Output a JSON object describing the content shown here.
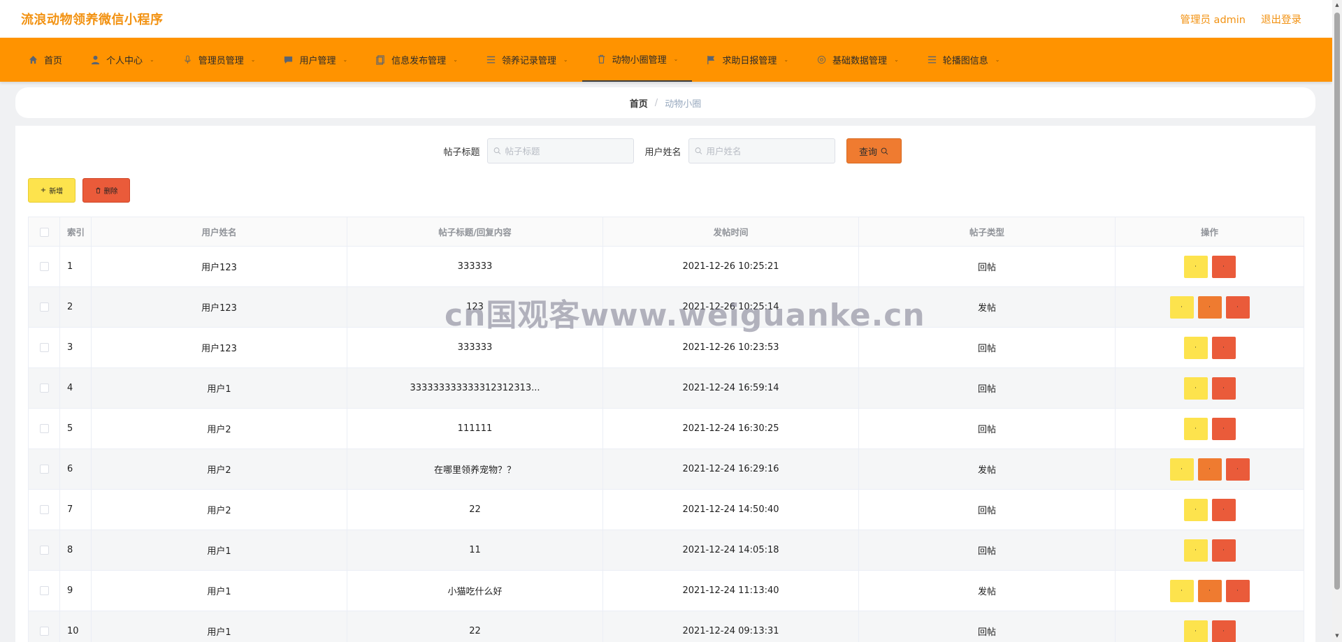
{
  "header": {
    "app_title": "流浪动物领养微信小程序",
    "admin_label": "管理员 admin",
    "logout_label": "退出登录"
  },
  "nav": {
    "items": [
      {
        "label": "首页",
        "icon": "home-icon"
      },
      {
        "label": "个人中心",
        "icon": "user-icon"
      },
      {
        "label": "管理员管理",
        "icon": "mic-icon"
      },
      {
        "label": "用户管理",
        "icon": "chat-icon"
      },
      {
        "label": "信息发布管理",
        "icon": "document-icon"
      },
      {
        "label": "领养记录管理",
        "icon": "list-icon"
      },
      {
        "label": "动物小圈管理",
        "icon": "trash-icon"
      },
      {
        "label": "求助日报管理",
        "icon": "flag-icon"
      },
      {
        "label": "基础数据管理",
        "icon": "gear-icon"
      },
      {
        "label": "轮播图信息",
        "icon": "list-icon"
      }
    ]
  },
  "breadcrumb": {
    "home": "首页",
    "separator": "/",
    "current": "动物小圈"
  },
  "search": {
    "title_label": "帖子标题",
    "title_placeholder": "帖子标题",
    "user_label": "用户姓名",
    "user_placeholder": "用户姓名",
    "query_label": "查询"
  },
  "actions": {
    "add_label": "新增",
    "delete_label": "删除"
  },
  "table": {
    "columns": [
      "索引",
      "用户姓名",
      "帖子标题/回复内容",
      "发帖时间",
      "帖子类型",
      "操作"
    ],
    "rows": [
      {
        "index": "1",
        "user": "用户123",
        "content": "333333",
        "time": "2021-12-26 10:25:21",
        "type": "回帖"
      },
      {
        "index": "2",
        "user": "用户123",
        "content": "123",
        "time": "2021-12-26 10:25:14",
        "type": "发帖"
      },
      {
        "index": "3",
        "user": "用户123",
        "content": "333333",
        "time": "2021-12-26 10:23:53",
        "type": "回帖"
      },
      {
        "index": "4",
        "user": "用户1",
        "content": "333333333333312312313...",
        "time": "2021-12-24 16:59:14",
        "type": "回帖"
      },
      {
        "index": "5",
        "user": "用户2",
        "content": "111111",
        "time": "2021-12-24 16:30:25",
        "type": "回帖"
      },
      {
        "index": "6",
        "user": "用户2",
        "content": "在哪里领养宠物？？",
        "time": "2021-12-24 16:29:16",
        "type": "发帖"
      },
      {
        "index": "7",
        "user": "用户2",
        "content": "22",
        "time": "2021-12-24 14:50:40",
        "type": "回帖"
      },
      {
        "index": "8",
        "user": "用户1",
        "content": "11",
        "time": "2021-12-24 14:05:18",
        "type": "回帖"
      },
      {
        "index": "9",
        "user": "用户1",
        "content": "小猫吃什么好",
        "time": "2021-12-24 11:13:40",
        "type": "发帖"
      },
      {
        "index": "10",
        "user": "用户1",
        "content": "22",
        "time": "2021-12-24 09:13:31",
        "type": "回帖"
      }
    ],
    "op_label": "·"
  },
  "watermark": "cn国观客www.weiguanke.cn",
  "colors": {
    "accent": "#ff9300",
    "title": "#f29212",
    "view_button": "#fde34d",
    "reply_button": "#ef7b30",
    "delete_button": "#ea5b3a"
  }
}
